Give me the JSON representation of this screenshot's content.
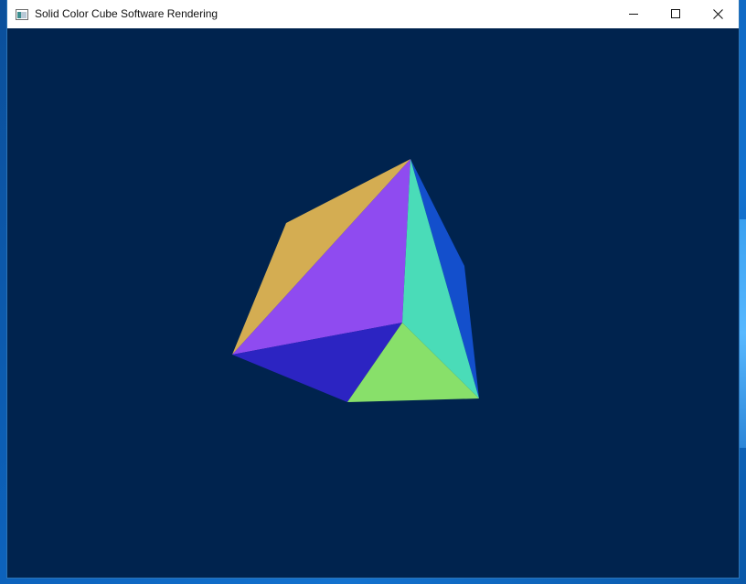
{
  "window": {
    "title": "Solid Color Cube Software Rendering",
    "background_color": "#00234e"
  },
  "titlebar": {
    "app_icon": "window-app-icon",
    "minimize_icon": "minimize-icon",
    "maximize_icon": "maximize-icon",
    "close_icon": "close-icon"
  },
  "scene": {
    "object": "solid color cube",
    "face_colors": {
      "gold": "#d4ad52",
      "purple": "#8f4bf0",
      "teal": "#4adcb8",
      "blue": "#134fcc",
      "indigo": "#2c24c2",
      "green": "#88e06a"
    }
  }
}
